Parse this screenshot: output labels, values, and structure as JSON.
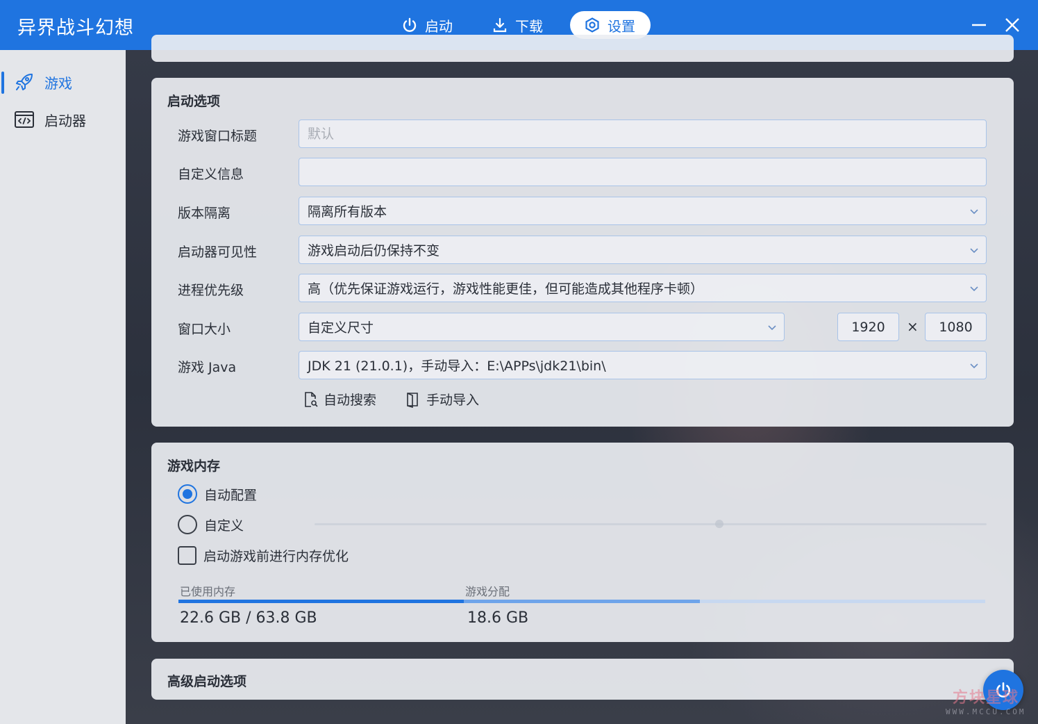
{
  "app": {
    "title": "异界战斗幻想"
  },
  "topnav": {
    "launch_label": "启动",
    "download_label": "下载",
    "settings_label": "设置"
  },
  "sidebar": {
    "items": [
      {
        "label": "游戏",
        "icon": "rocket-icon",
        "active": true
      },
      {
        "label": "启动器",
        "icon": "code-window-icon",
        "active": false
      }
    ]
  },
  "launch_options": {
    "title": "启动选项",
    "window_title": {
      "label": "游戏窗口标题",
      "value": "",
      "placeholder": "默认"
    },
    "custom_info": {
      "label": "自定义信息",
      "value": ""
    },
    "version_isolation": {
      "label": "版本隔离",
      "selected": "隔离所有版本"
    },
    "launcher_visibility": {
      "label": "启动器可见性",
      "selected": "游戏启动后仍保持不变"
    },
    "process_priority": {
      "label": "进程优先级",
      "selected": "高（优先保证游戏运行，游戏性能更佳，但可能造成其他程序卡顿）"
    },
    "window_size": {
      "label": "窗口大小",
      "selected": "自定义尺寸",
      "width": "1920",
      "height": "1080",
      "separator": "×"
    },
    "game_java": {
      "label": "游戏 Java",
      "selected": "JDK 21 (21.0.1)，手动导入：E:\\APPs\\jdk21\\bin\\"
    },
    "auto_search_label": "自动搜索",
    "manual_import_label": "手动导入"
  },
  "memory": {
    "title": "游戏内存",
    "auto_label": "自动配置",
    "custom_label": "自定义",
    "optimize_label": "启动游戏前进行内存优化",
    "mode": "auto",
    "optimize_checked": false,
    "used_label": "已使用内存",
    "used_value": "22.6 GB / 63.8 GB",
    "alloc_label": "游戏分配",
    "alloc_value": "18.6 GB",
    "used_fraction": 0.354,
    "alloc_fraction": 0.292
  },
  "advanced": {
    "title": "高级启动选项"
  },
  "watermark": {
    "brand": "方块星球",
    "url": "WWW.MCCU.COM"
  },
  "colors": {
    "accent": "#1f74e0",
    "sidebar_bg": "#e4e6ea"
  }
}
